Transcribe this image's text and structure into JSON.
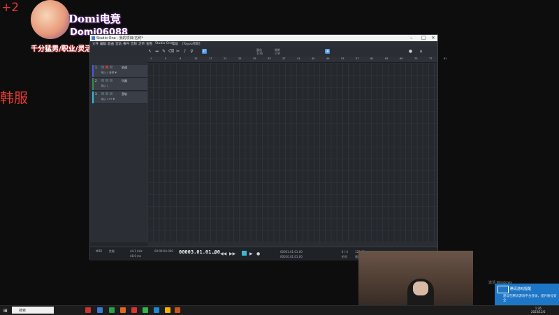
{
  "overlay": {
    "plus": "+2",
    "side": "韩服",
    "title": "Domi电竞",
    "id": "Domi06088",
    "tagline": "千分猛男/职业/灵活战队"
  },
  "daw": {
    "window_title": "Studio One - 我的项目/名称*",
    "menus": [
      "文件",
      "编辑",
      "歌曲",
      "音轨",
      "事件",
      "音频",
      "走带",
      "查看",
      "Studio One",
      "帮助",
      "[Fayvo项目]"
    ],
    "toolbar": {
      "quantize": "1/16",
      "snap": "小节",
      "grid": "量化",
      "mode": "吸附",
      "buttons": [
        "↖",
        "↔",
        "✎",
        "⌫",
        "✂",
        "♪",
        "⚲",
        "⇵",
        "⊞"
      ]
    },
    "ruler": [
      "1",
      "5",
      "9",
      "13",
      "17",
      "21",
      "25",
      "29",
      "33",
      "37",
      "41",
      "45",
      "49",
      "53",
      "57",
      "61",
      "65",
      "69",
      "73",
      "77",
      "81"
    ],
    "tracks": [
      {
        "num": "1",
        "name": "轨道",
        "inst": "输入 L  音频 ▼",
        "color": "#4f56d6"
      },
      {
        "num": "2",
        "name": "乐器",
        "inst": "输入 L",
        "color": "#3a8a4a"
      },
      {
        "num": "3",
        "name": "音轨",
        "inst": "输入 L+R  ▼",
        "color": "#3fb8d6"
      }
    ],
    "transport": {
      "cpu": "44.1 kHz",
      "latency": "48.0 ms",
      "duration": "00:00:04.000",
      "time": "00003.01.01.00",
      "left": "00001.01.01.00",
      "right": "00010.01.01.00",
      "tempo": "4 / 4",
      "bpm": "120.00",
      "labels": [
        "MIDI",
        "性能",
        "秒",
        "小节",
        "节拍器",
        "节拍",
        "速度",
        "拍号"
      ]
    }
  },
  "desktop": {
    "activate": "激活 Windows",
    "toast_title": "腾讯游戏提醒",
    "toast_body": "建议在腾讯游戏平台登录，提升账号安全",
    "search": "搜索",
    "time": "1:26",
    "date": "2023/12/5"
  }
}
